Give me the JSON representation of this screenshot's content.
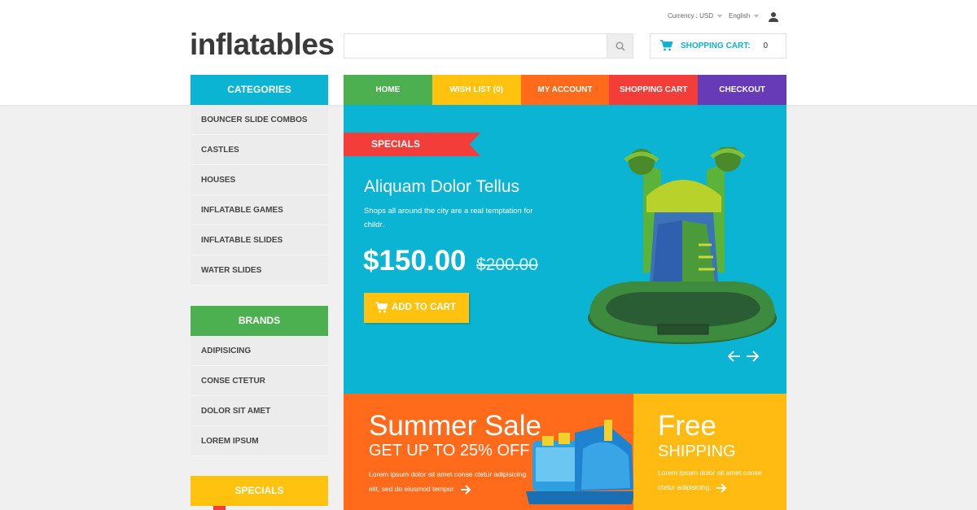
{
  "topbar": {
    "currency": "Currency : USD",
    "language": "English"
  },
  "logo": "inflatables",
  "search": {
    "placeholder": ""
  },
  "cart": {
    "label": "SHOPPING CART:",
    "count": "0"
  },
  "categories": {
    "title": "CATEGORIES",
    "items": [
      "BOUNCER SLIDE COMBOS",
      "CASTLES",
      "HOUSES",
      "INFLATABLE GAMES",
      "INFLATABLE SLIDES",
      "WATER SLIDES"
    ]
  },
  "brands": {
    "title": "BRANDS",
    "items": [
      "ADIPISICING",
      "CONSE CTETUR",
      "DOLOR SIT AMET",
      "LOREM IPSUM"
    ]
  },
  "specials_block": {
    "title": "SPECIALS"
  },
  "nav": [
    "HOME",
    "WISH LIST (0)",
    "MY ACCOUNT",
    "SHOPPING CART",
    "CHECKOUT"
  ],
  "hero": {
    "ribbon": "SPECIALS",
    "title": "Aliquam Dolor Tellus",
    "description": "Shops all around the city are a real temptation for childr..",
    "price": "$150.00",
    "old_price": "$200.00",
    "button": "ADD TO CART"
  },
  "promo1": {
    "title": "Summer Sale",
    "subtitle": "GET UP TO 25% OFF",
    "text": "Lorem ipsum dolor sit amet conse ctetur adipisicing elit, sed do eiusmod tempor."
  },
  "promo2": {
    "title": "Free",
    "subtitle": "SHIPPING",
    "text": "Lorem ipsum dolor sit amet conse ctetur adipisicing."
  },
  "colors": {
    "teal": "#0ab4d2",
    "green": "#4caf50",
    "yellow": "#ffc20e",
    "orange": "#ff6b1b",
    "red": "#f23d38",
    "purple": "#673ab7"
  },
  "icons": [
    "user-icon",
    "search-icon",
    "cart-icon",
    "arrow-left-icon",
    "arrow-right-icon"
  ]
}
